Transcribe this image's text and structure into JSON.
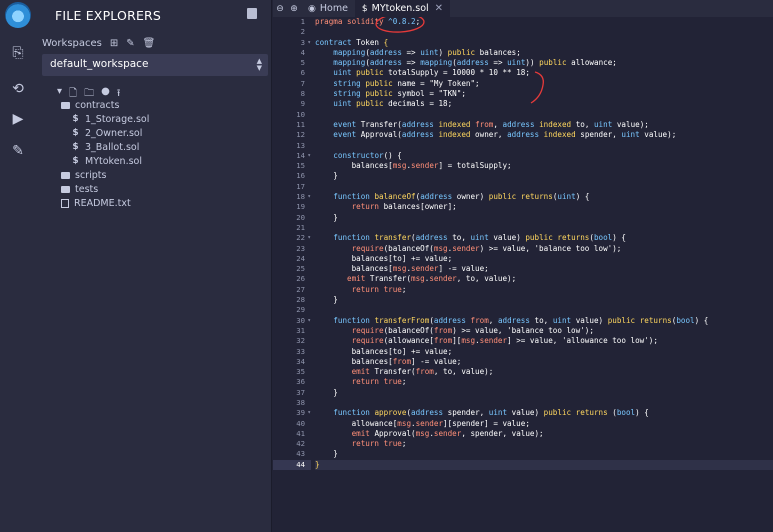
{
  "sidebar": {
    "title": "FILE EXPLORERS",
    "workspaces_label": "Workspaces",
    "workspace_selected": "default_workspace",
    "tree": [
      {
        "label": "contracts",
        "type": "folder",
        "level": 1
      },
      {
        "label": "1_Storage.sol",
        "type": "sol",
        "level": 2
      },
      {
        "label": "2_Owner.sol",
        "type": "sol",
        "level": 2
      },
      {
        "label": "3_Ballot.sol",
        "type": "sol",
        "level": 2
      },
      {
        "label": "MYtoken.sol",
        "type": "sol",
        "level": 2
      },
      {
        "label": "scripts",
        "type": "folder",
        "level": 1
      },
      {
        "label": "tests",
        "type": "folder",
        "level": 1
      },
      {
        "label": "README.txt",
        "type": "doc",
        "level": 1
      }
    ]
  },
  "tabs": [
    {
      "label": "Home",
      "icon": "home-logo-icon",
      "active": false
    },
    {
      "label": "MYtoken.sol",
      "icon": "solidity-icon",
      "active": true
    }
  ],
  "editor": {
    "active_line": 44,
    "line_count": 44,
    "colors": {
      "keyword": "#ff8f78",
      "type": "#79c7ff",
      "highlight": "#ffd75f",
      "annotation": "#e53a3a"
    }
  }
}
